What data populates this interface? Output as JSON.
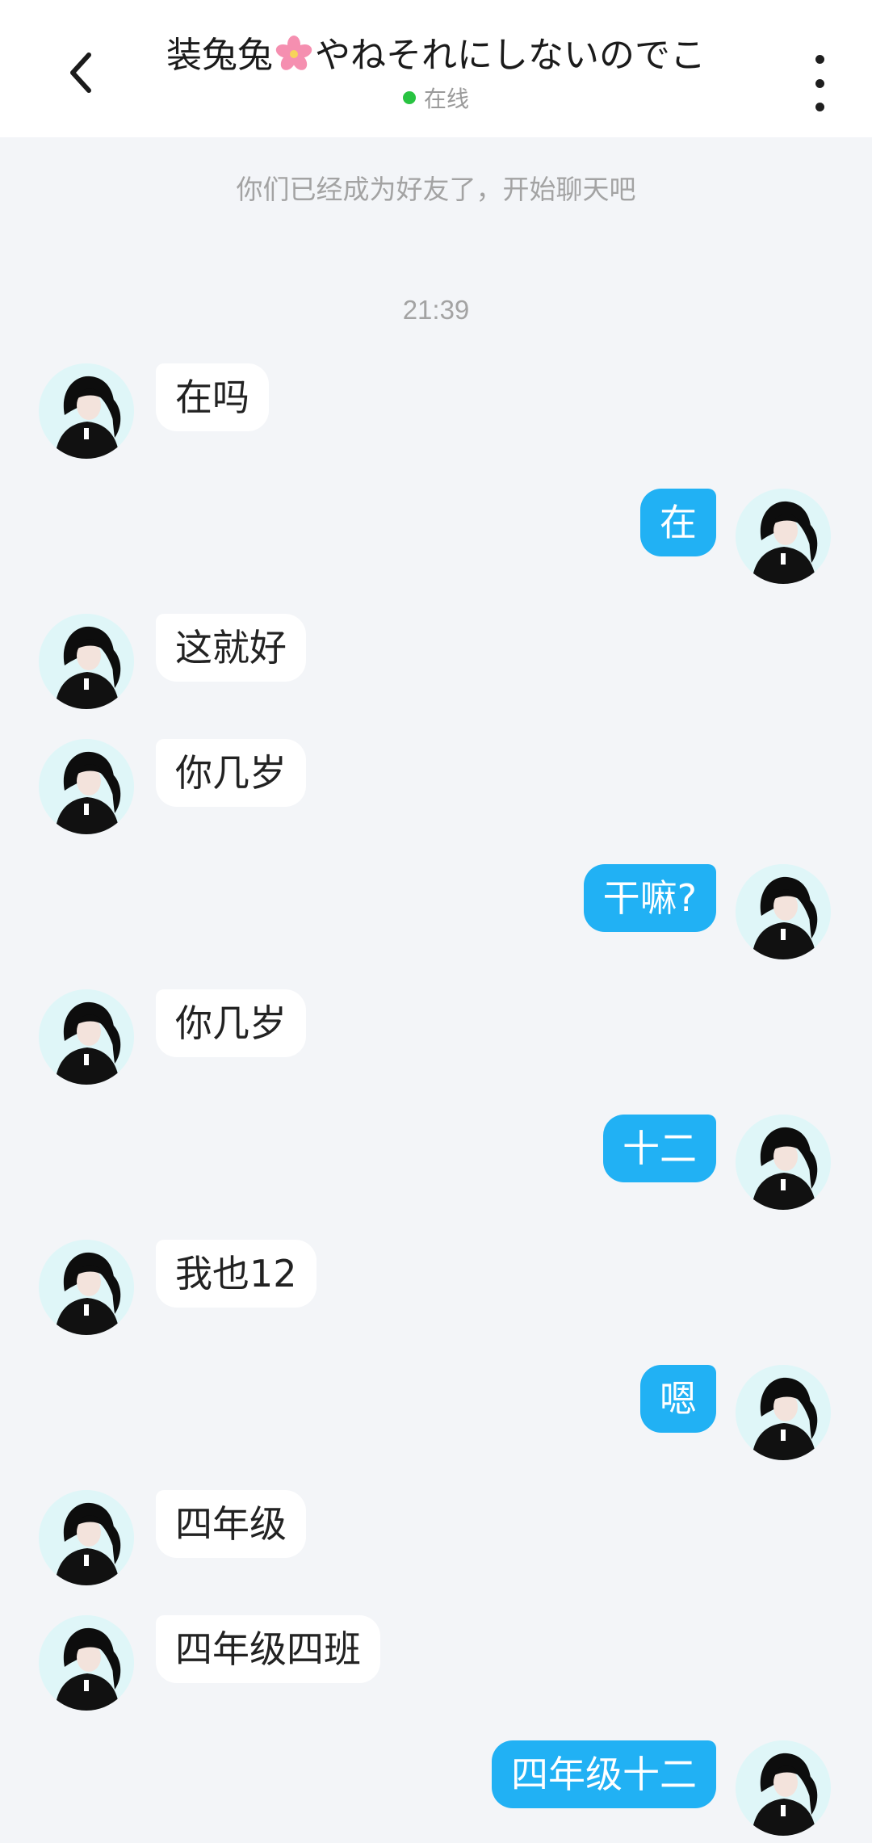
{
  "header": {
    "title_before": "装兔兔",
    "title_flower_icon": "cherry-blossom-icon",
    "title_after": "やねそれにしないのでこ",
    "status": "在线",
    "back_icon": "chevron-left-icon",
    "more_icon": "vertical-dots-icon"
  },
  "chat": {
    "system_message": "你们已经成为好友了，开始聊天吧",
    "timestamp": "21:39",
    "messages": [
      {
        "side": "in",
        "text": "在吗"
      },
      {
        "side": "out",
        "text": "在"
      },
      {
        "side": "in",
        "text": "这就好"
      },
      {
        "side": "in",
        "text": "你几岁"
      },
      {
        "side": "out",
        "text": "干嘛?"
      },
      {
        "side": "in",
        "text": "你几岁"
      },
      {
        "side": "out",
        "text": "十二"
      },
      {
        "side": "in",
        "text": "我也12"
      },
      {
        "side": "out",
        "text": "嗯"
      },
      {
        "side": "in",
        "text": "四年级"
      },
      {
        "side": "in",
        "text": "四年级四班"
      },
      {
        "side": "out",
        "text": "四年级十二"
      }
    ]
  },
  "colors": {
    "background": "#f3f5f8",
    "header_bg": "#ffffff",
    "outgoing_bubble": "#21b1f4",
    "incoming_bubble": "#ffffff",
    "online_dot": "#28c341",
    "muted_text": "#a3a3a3"
  }
}
